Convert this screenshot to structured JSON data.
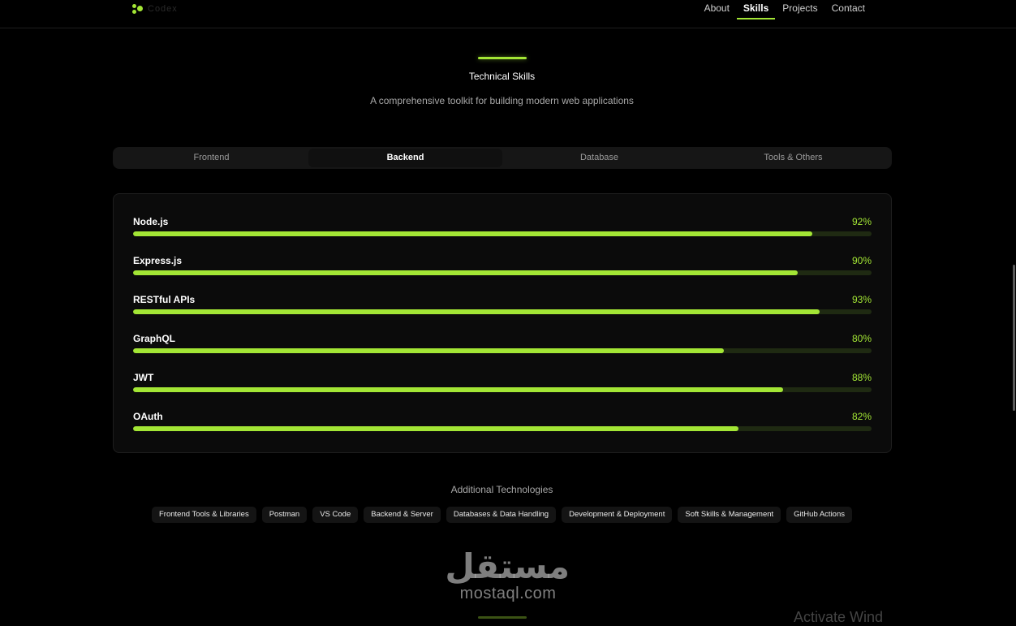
{
  "brand": {
    "name": "Codex"
  },
  "nav": {
    "items": [
      {
        "label": "About",
        "active": false
      },
      {
        "label": "Skills",
        "active": true
      },
      {
        "label": "Projects",
        "active": false
      },
      {
        "label": "Contact",
        "active": false
      }
    ]
  },
  "section": {
    "title": "Technical Skills",
    "subtitle": "A comprehensive toolkit for building modern web applications"
  },
  "tabs": [
    {
      "label": "Frontend",
      "active": false
    },
    {
      "label": "Backend",
      "active": true
    },
    {
      "label": "Database",
      "active": false
    },
    {
      "label": "Tools & Others",
      "active": false
    }
  ],
  "skills": [
    {
      "name": "Node.js",
      "percent_label": "92%",
      "percent": 92
    },
    {
      "name": "Express.js",
      "percent_label": "90%",
      "percent": 90
    },
    {
      "name": "RESTful APIs",
      "percent_label": "93%",
      "percent": 93
    },
    {
      "name": "GraphQL",
      "percent_label": "80%",
      "percent": 80
    },
    {
      "name": "JWT",
      "percent_label": "88%",
      "percent": 88
    },
    {
      "name": "OAuth",
      "percent_label": "82%",
      "percent": 82
    }
  ],
  "additional": {
    "title": "Additional Technologies",
    "chips": [
      "Frontend Tools & Libraries",
      "Postman",
      "VS Code",
      "Backend & Server",
      "Databases & Data Handling",
      "Development & Deployment",
      "Soft Skills & Management",
      "GitHub Actions"
    ]
  },
  "watermark": {
    "arabic": "مستقل",
    "latin": "mostaql.com"
  },
  "os_overlay": {
    "text": "Activate Wind"
  },
  "colors": {
    "accent": "#a3e635",
    "track": "#1f2a12",
    "background": "#000000",
    "card": "#0b0b0b"
  }
}
